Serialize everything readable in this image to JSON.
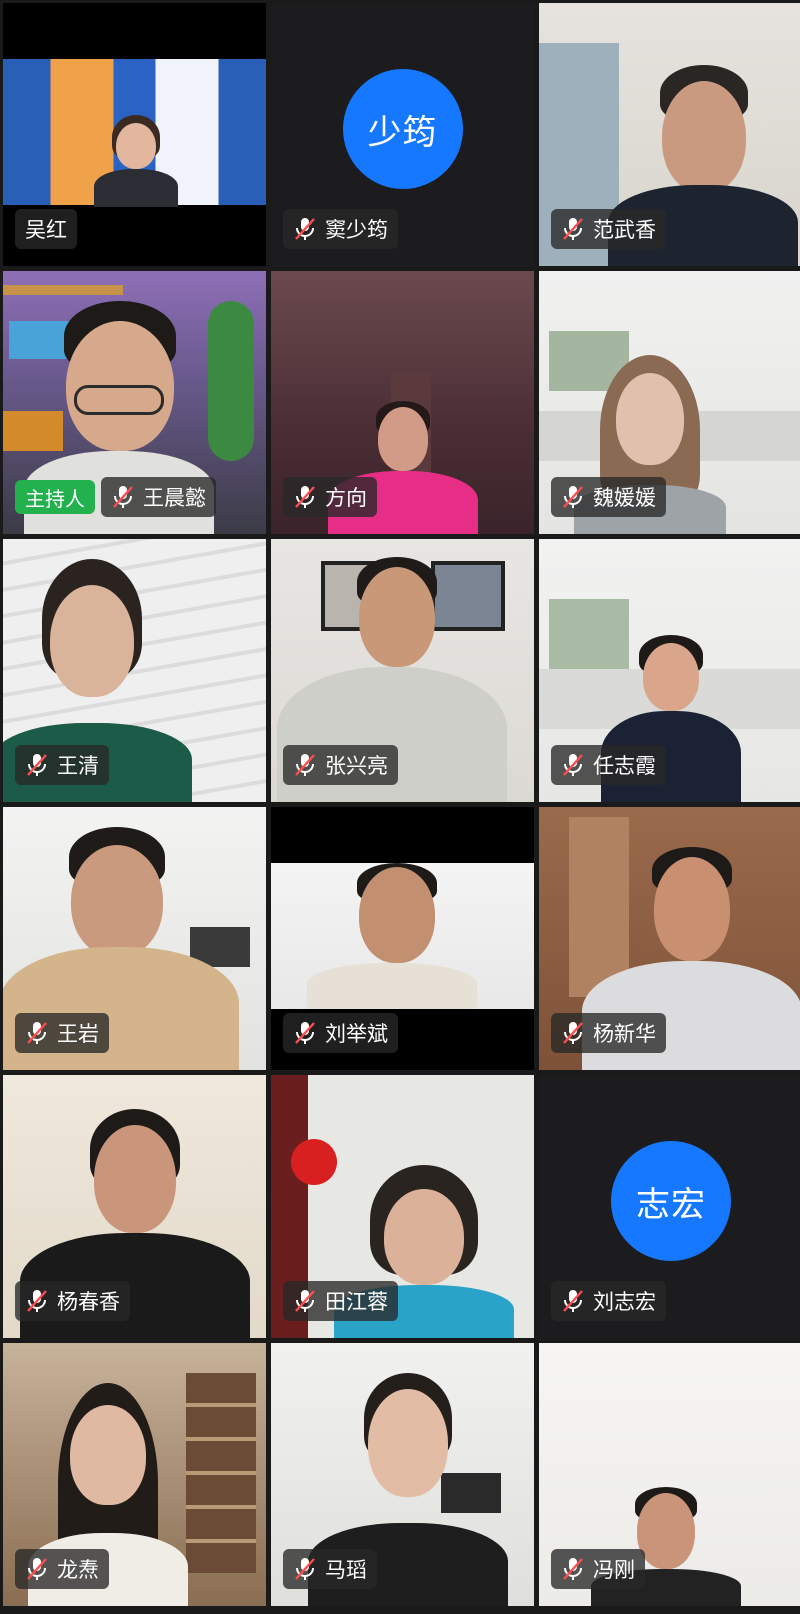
{
  "meeting": {
    "host_badge": "主持人",
    "participants": [
      {
        "name": "吴红",
        "muted": false,
        "avatar": ""
      },
      {
        "name": "窦少筠",
        "muted": true,
        "avatar": "少筠"
      },
      {
        "name": "范武香",
        "muted": true,
        "avatar": ""
      },
      {
        "name": "王晨懿",
        "muted": true,
        "avatar": "",
        "host": true
      },
      {
        "name": "方向",
        "muted": true,
        "avatar": ""
      },
      {
        "name": "魏媛媛",
        "muted": true,
        "avatar": ""
      },
      {
        "name": "王清",
        "muted": true,
        "avatar": ""
      },
      {
        "name": "张兴亮",
        "muted": true,
        "avatar": ""
      },
      {
        "name": "任志霞",
        "muted": true,
        "avatar": ""
      },
      {
        "name": "王岩",
        "muted": true,
        "avatar": ""
      },
      {
        "name": "刘举斌",
        "muted": true,
        "avatar": ""
      },
      {
        "name": "杨新华",
        "muted": true,
        "avatar": ""
      },
      {
        "name": "杨春香",
        "muted": true,
        "avatar": ""
      },
      {
        "name": "田江蓉",
        "muted": true,
        "avatar": ""
      },
      {
        "name": "刘志宏",
        "muted": true,
        "avatar": "志宏"
      },
      {
        "name": "龙焘",
        "muted": true,
        "avatar": ""
      },
      {
        "name": "马瑫",
        "muted": true,
        "avatar": ""
      },
      {
        "name": "冯刚",
        "muted": true,
        "avatar": ""
      }
    ]
  },
  "colors": {
    "avatar_bg": "#1677ff",
    "host_badge": "#22b14c",
    "mute_icon": "#ff4d4f"
  }
}
